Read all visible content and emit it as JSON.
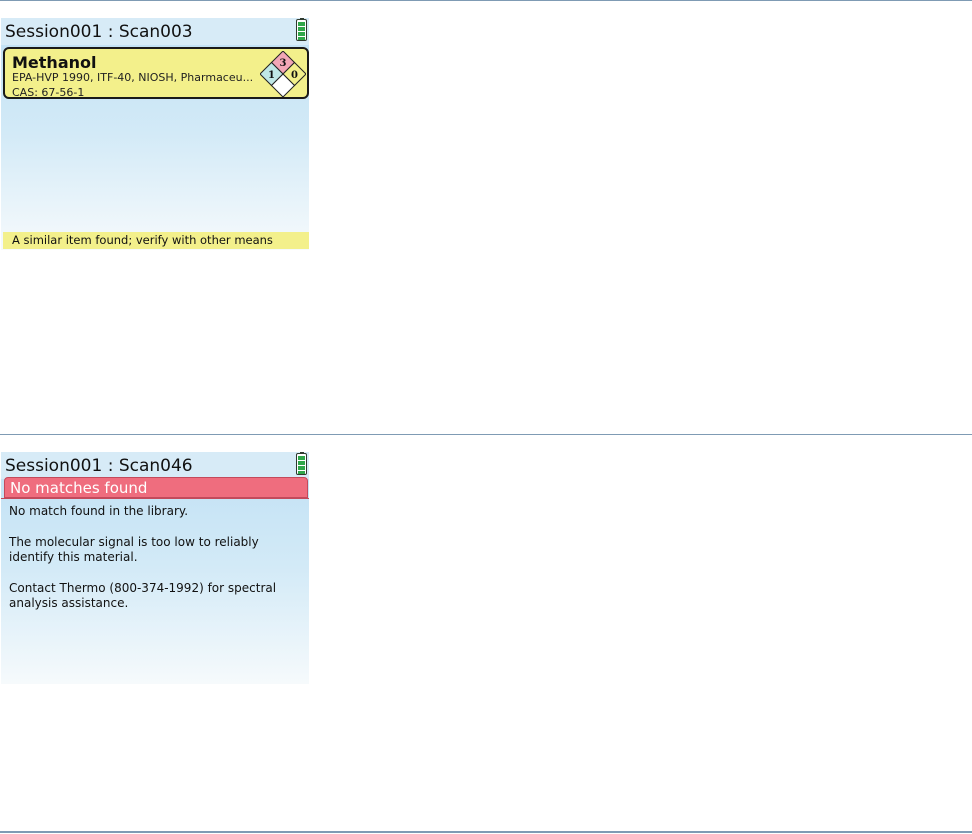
{
  "panels": [
    {
      "title": "Session001 : Scan003",
      "result": {
        "name": "Methanol",
        "sources": "EPA-HVP 1990, ITF-40, NIOSH, Pharmaceu...",
        "cas": "CAS: 67-56-1",
        "nfpa": {
          "health": "1",
          "flammability": "3",
          "instability": "0"
        }
      },
      "notice": "A similar item found; verify with other means"
    },
    {
      "title": "Session001 : Scan046",
      "header": "No matches found",
      "messages": [
        "No match found in the library.",
        "The molecular signal is too low to reliably identify this material.",
        "Contact Thermo (800-374-1992) for spectral analysis assistance."
      ]
    }
  ],
  "colors": {
    "match_yellow": "#f3f08b",
    "error_red": "#ef6d7e",
    "nfpa_health": "#bfe7e6",
    "nfpa_flammability": "#f3a6b6",
    "nfpa_instability": "#f3f08b",
    "battery_green": "#2fa64a"
  },
  "icons": [
    "battery-icon",
    "nfpa-diamond-icon"
  ]
}
